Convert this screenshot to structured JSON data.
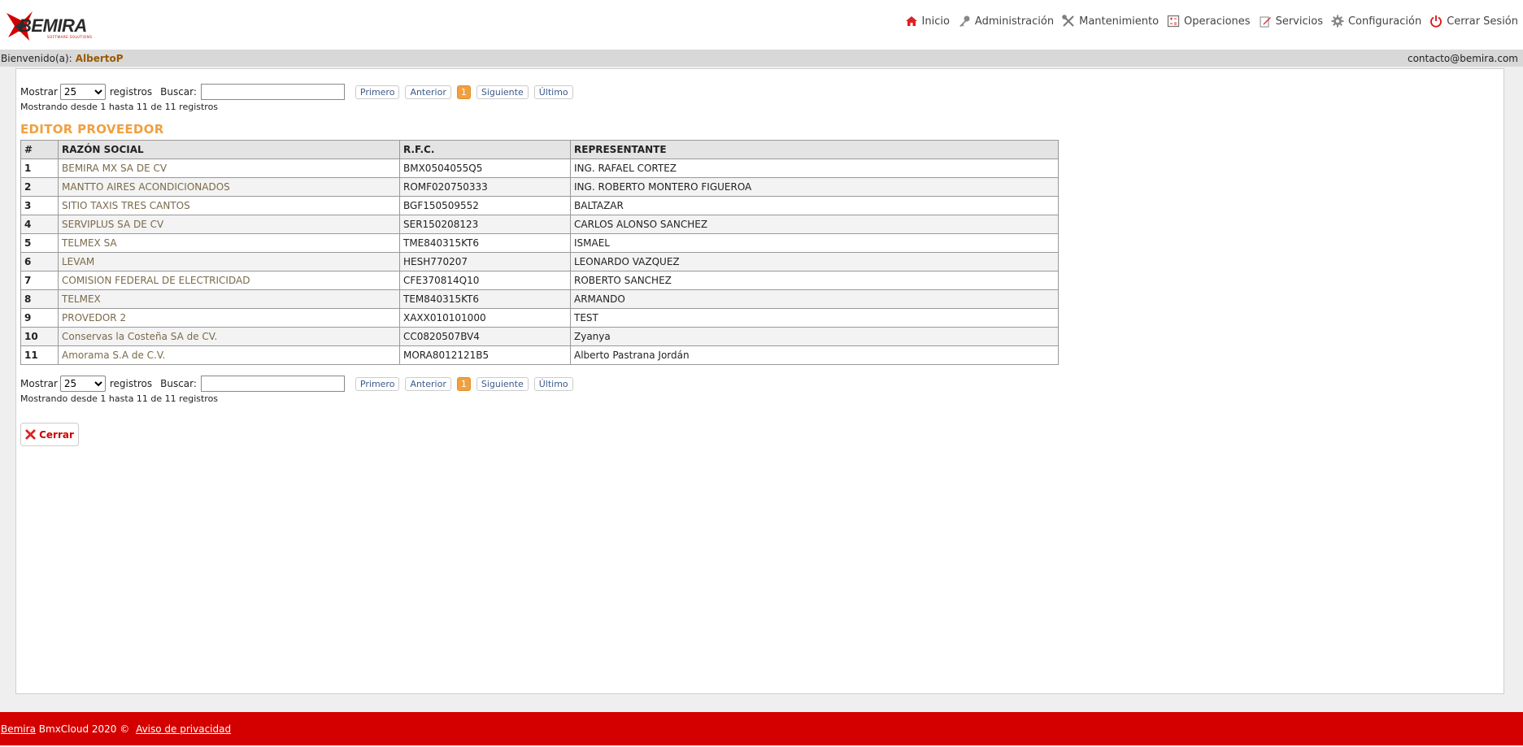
{
  "brand": {
    "logo_text": "BEMIRA",
    "logo_tagline": "SOFTWARE SOLUTIONS"
  },
  "nav": [
    {
      "label": "Inicio",
      "icon": "home-icon"
    },
    {
      "label": "Administración",
      "icon": "key-icon"
    },
    {
      "label": "Mantenimiento",
      "icon": "tools-icon"
    },
    {
      "label": "Operaciones",
      "icon": "calculator-icon"
    },
    {
      "label": "Servicios",
      "icon": "edit-icon"
    },
    {
      "label": "Configuración",
      "icon": "gear-icon"
    },
    {
      "label": "Cerrar Sesión",
      "icon": "power-icon"
    }
  ],
  "userbar": {
    "welcome": "Bienvenido(a):",
    "user": "AlbertoP",
    "email": "contacto@bemira.com"
  },
  "controls": {
    "show_label": "Mostrar",
    "show_value": "25",
    "records_label": "registros",
    "search_label": "Buscar:",
    "search_value": "",
    "pager": {
      "first": "Primero",
      "prev": "Anterior",
      "current": "1",
      "next": "Siguiente",
      "last": "Último"
    },
    "info": "Mostrando desde 1 hasta 11 de 11 registros"
  },
  "page_title": "EDITOR PROVEEDOR",
  "table": {
    "headers": [
      "#",
      "RAZÓN SOCIAL",
      "R.F.C.",
      "REPRESENTANTE"
    ],
    "rows": [
      [
        "1",
        "BEMIRA MX SA DE CV",
        "BMX0504055Q5",
        "ING. RAFAEL CORTEZ"
      ],
      [
        "2",
        "MANTTO AIRES ACONDICIONADOS",
        "ROMF020750333",
        "ING. ROBERTO MONTERO FIGUEROA"
      ],
      [
        "3",
        "SITIO TAXIS TRES CANTOS",
        "BGF150509552",
        "BALTAZAR"
      ],
      [
        "4",
        "SERVIPLUS SA DE CV",
        "SER150208123",
        "CARLOS ALONSO SANCHEZ"
      ],
      [
        "5",
        "TELMEX SA",
        "TME840315KT6",
        "ISMAEL"
      ],
      [
        "6",
        "LEVAM",
        "HESH770207",
        "LEONARDO VAZQUEZ"
      ],
      [
        "7",
        "COMISION FEDERAL DE ELECTRICIDAD",
        "CFE370814Q10",
        "ROBERTO SANCHEZ"
      ],
      [
        "8",
        "TELMEX",
        "TEM840315KT6",
        "ARMANDO"
      ],
      [
        "9",
        "PROVEDOR 2",
        "XAXX010101000",
        "TEST"
      ],
      [
        "10",
        "Conservas la Costeña SA de CV.",
        "CC0820507BV4",
        "Zyanya"
      ],
      [
        "11",
        "Amorama S.A de C.V.",
        "MORA8012121B5",
        "Alberto Pastrana Jordán"
      ]
    ]
  },
  "close_button": "Cerrar",
  "footer": {
    "brand": "Bemira",
    "text": "BmxCloud 2020 ©",
    "privacy": "Aviso de privacidad"
  },
  "colors": {
    "accent_orange": "#f0a040",
    "footer_red": "#d40000",
    "link_brown": "#7a6a4a"
  }
}
